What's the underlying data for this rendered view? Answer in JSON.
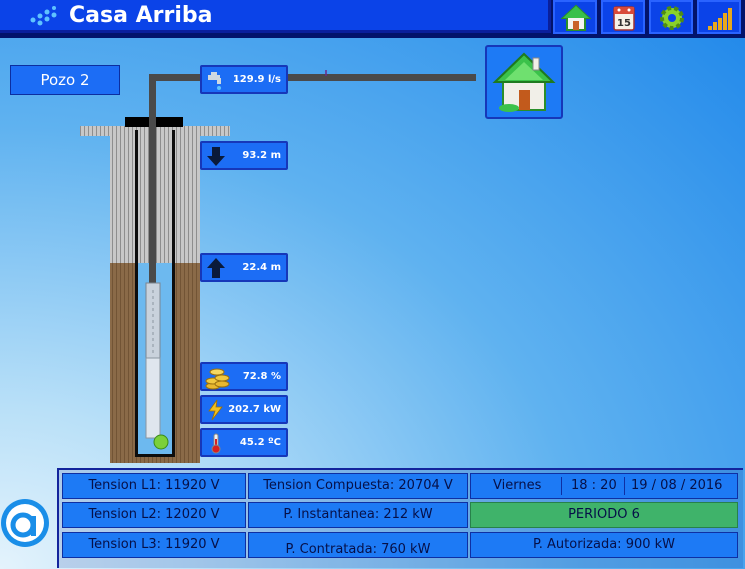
{
  "header": {
    "title": "Casa Arriba"
  },
  "nav": {
    "icons": [
      "home-icon",
      "calendar-icon",
      "gear-icon",
      "signal-bars-icon"
    ],
    "calendar_day": "15"
  },
  "well": {
    "name": "Pozo 2",
    "flow": "129.9 l/s",
    "depth_down": "93.2 m",
    "level_up": "22.4 m",
    "efficiency": "72.8 %",
    "power": "202.7 kW",
    "temperature": "45.2 ºC"
  },
  "status": {
    "tension_l1": "Tension L1: 11920 V",
    "tension_l2": "Tension L2: 12020 V",
    "tension_l3": "Tension L3: 11920 V",
    "tension_compuesta": "Tension Compuesta: 20704 V",
    "p_instantanea": "P. Instantanea: 212 kW",
    "p_contratada": "P. Contratada: 760 kW",
    "day": "Viernes",
    "time": "18 : 20",
    "date": "19 / 08 / 2016",
    "periodo": "PERIODO 6",
    "p_autorizada": "P. Autorizada: 900 kW"
  },
  "colors": {
    "accent": "#0b43e8",
    "panel": "#1d7af5",
    "period_active": "#3fb36a",
    "soil": "#7a5a3a",
    "water": "#6db9ef"
  }
}
